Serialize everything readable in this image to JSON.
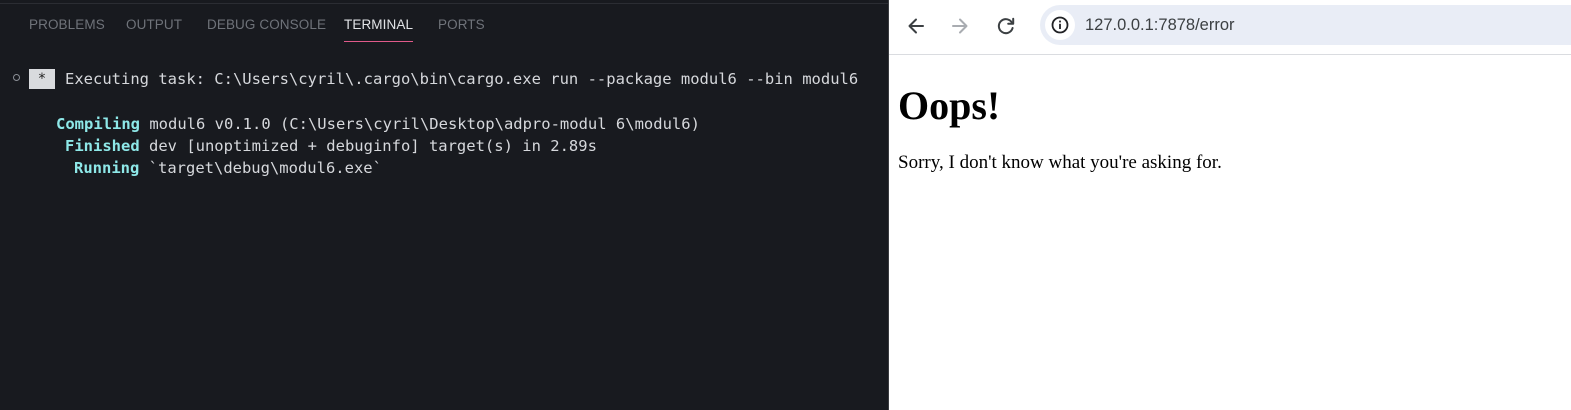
{
  "vscode_panel": {
    "tabs": [
      {
        "label": "PROBLEMS"
      },
      {
        "label": "OUTPUT"
      },
      {
        "label": "DEBUG CONSOLE"
      },
      {
        "label": "TERMINAL"
      },
      {
        "label": "PORTS"
      }
    ],
    "active_tab": "TERMINAL",
    "terminal": {
      "task_badge": "*",
      "task_text": "Executing task: C:\\Users\\cyril\\.cargo\\bin\\cargo.exe run --package modul6 --bin modul6",
      "lines": [
        {
          "keyword": "Compiling",
          "text": " modul6 v0.1.0 (C:\\Users\\cyril\\Desktop\\adpro-modul 6\\modul6)"
        },
        {
          "keyword": "Finished",
          "text": " dev [unoptimized + debuginfo] target(s) in 2.89s"
        },
        {
          "keyword": "Running",
          "text": " `target\\debug\\modul6.exe`"
        }
      ]
    }
  },
  "browser": {
    "url": "127.0.0.1:7878/error",
    "page": {
      "heading": "Oops!",
      "message": "Sorry, I don't know what you're asking for."
    }
  },
  "colors": {
    "terminal_bg": "#181a1f",
    "tab_inactive": "#6f737a",
    "tab_active": "#e1e3e6",
    "tab_active_underline": "#e05a8a",
    "cargo_keyword": "#8ee8e8",
    "omnibox_bg": "#e9edf6"
  },
  "icons": {
    "back": "arrow-left-icon",
    "forward": "arrow-right-icon",
    "reload": "reload-icon",
    "site_info": "info-icon"
  }
}
